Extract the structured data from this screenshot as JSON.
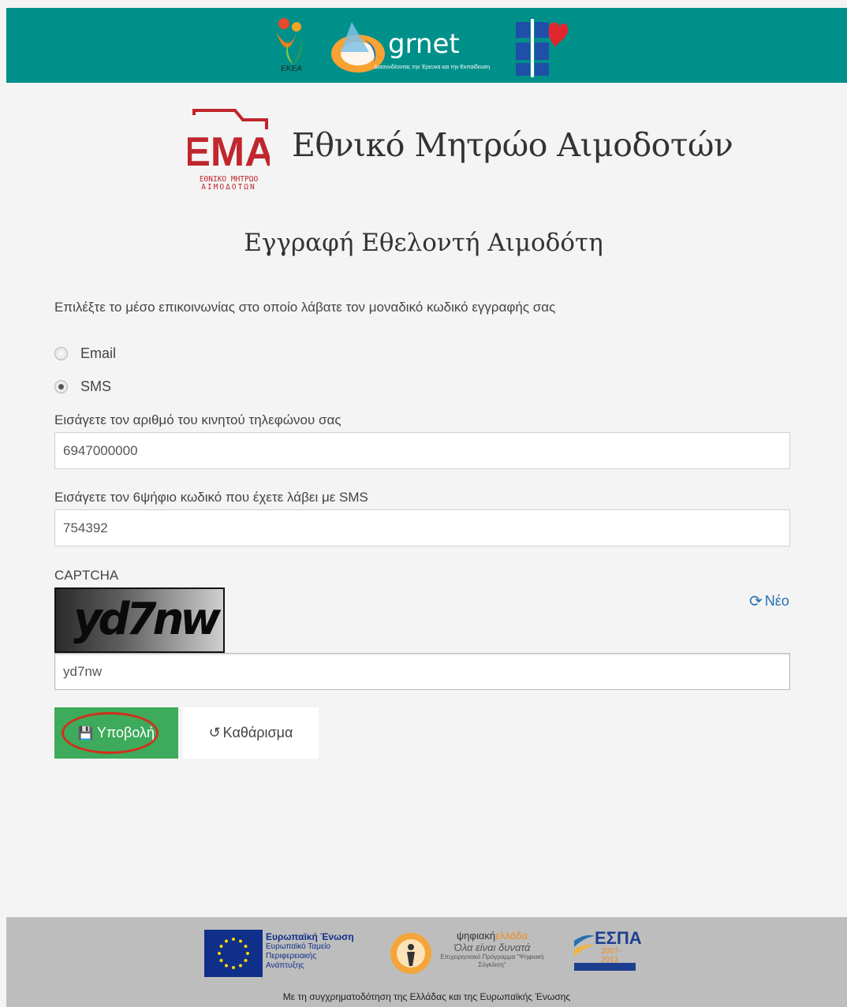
{
  "header": {
    "logos": {
      "ekea_text": "ΕΚΕΑ",
      "grnet_word": "grnet",
      "grnet_sub": "Διασυνδέοντας την Έρευνα και την Εκπαίδευση"
    }
  },
  "brand": {
    "logo_letters": "ΕΜΑ",
    "logo_sub1": "ΕΘΝΙΚΟ ΜΗΤΡΩΟ",
    "logo_sub2": "ΑΙΜΟΔΟΤΩΝ",
    "title": "Εθνικό Μητρώο Αιμοδοτών"
  },
  "page_title": "Εγγραφή Εθελοντή Αιμοδότη",
  "form": {
    "instruction": "Επιλέξτε το μέσο επικοινωνίας στο οποίο λάβατε τον μοναδικό κωδικό εγγραφής σας",
    "options": [
      {
        "label": "Email",
        "checked": false
      },
      {
        "label": "SMS",
        "checked": true
      }
    ],
    "phone_label": "Εισάγετε τον αριθμό του κινητού τηλεφώνου σας",
    "phone_value": "6947000000",
    "code_label": "Εισάγετε τον 6ψήφιο κωδικό που έχετε λάβει με SMS",
    "code_value": "754392",
    "captcha_label": "CAPTCHA",
    "captcha_image_text": "yd7nw",
    "captcha_value": "yd7nw",
    "refresh_label": "Νέο",
    "submit_label": "Υποβολή",
    "clear_label": "Καθάρισμα"
  },
  "footer": {
    "eu_title": "Ευρωπαϊκή Ένωση",
    "eu_sub": "Ευρωπαϊκό Ταμείο Περιφερειακής Ανάπτυξης",
    "psif_brand_a": "ψηφιακή",
    "psif_brand_b": "ελλάδα",
    "psif_slogan": "Όλα είναι δυνατά",
    "psif_program": "Επιχειρησιακό Πρόγραμμα \"Ψηφιακή Σύγκλιση\"",
    "espa_title": "ΕΣΠΑ",
    "espa_years": "2007-2013",
    "caption": "Με τη συγχρηματοδότηση της Ελλάδας και της Ευρωπαϊκής Ένωσης"
  },
  "colors": {
    "header_bg": "#00908a",
    "brand_red": "#c0262d",
    "submit_green": "#3eaa5c",
    "highlight_red": "#d0301c",
    "link_blue": "#2a6fb0",
    "footer_bg": "#bdbdbd"
  }
}
